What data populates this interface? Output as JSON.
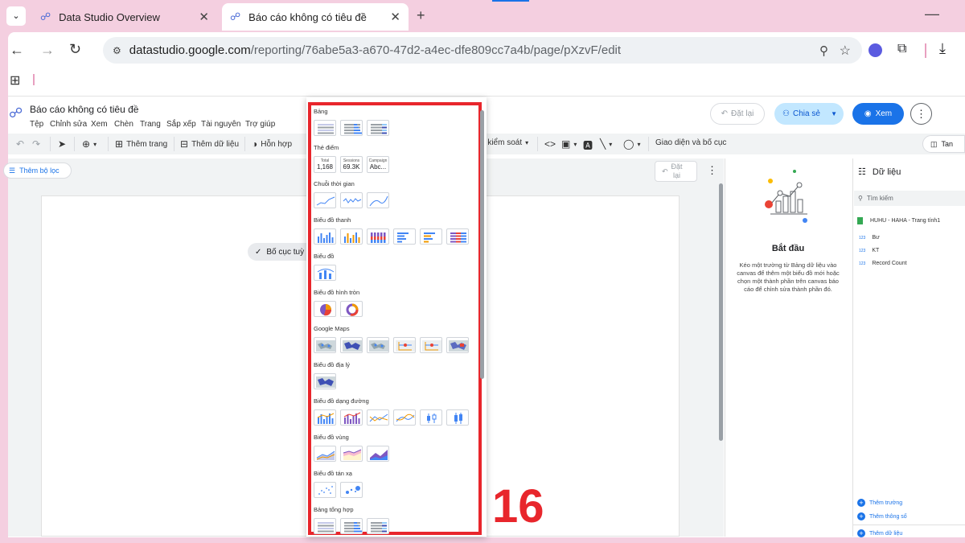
{
  "browser": {
    "tabs": [
      {
        "title": "Data Studio Overview"
      },
      {
        "title": "Báo cáo không có tiêu đề"
      }
    ],
    "url_host": "datastudio.google.com",
    "url_path": "/reporting/76abe5a3-a670-47d2-a4ec-dfe809cc7a4b/page/pXzvF/edit"
  },
  "report": {
    "title": "Báo cáo không có tiêu đề",
    "menu": [
      "Tệp",
      "Chỉnh sửa",
      "Xem",
      "Chèn",
      "Trang",
      "Sắp xếp",
      "Tài nguyên",
      "Trợ giúp"
    ],
    "undo_btn": "Đặt lại",
    "share_btn": "Chia sẻ",
    "view_btn": "Xem"
  },
  "toolbar": {
    "add_page": "Thêm trang",
    "add_data": "Thêm dữ liệu",
    "blend": "Hỗn hợp",
    "controls": "n kiểm soát",
    "theme": "Giao diện và bố cục",
    "right_btn": "Tan"
  },
  "canvas": {
    "add_filter": "Thêm bộ lọc",
    "layout_chip": "Bố cục tuỳ",
    "reset_label_1": "Đặt",
    "reset_label_2": "lại"
  },
  "chart_panel": {
    "categories": {
      "table": "Bảng",
      "scorecard": "Thẻ điểm",
      "timeseries": "Chuỗi thời gian",
      "bar": "Biểu đồ thanh",
      "chart": "Biểu đồ",
      "pie": "Biểu đồ hình tròn",
      "google_maps": "Google Maps",
      "geo": "Biểu đồ địa lý",
      "line": "Biểu đồ dạng đường",
      "area": "Biểu đồ vùng",
      "scatter": "Biểu đồ tán xạ",
      "pivot": "Bảng tổng hợp"
    },
    "scorecards": [
      {
        "label": "Total",
        "value": "1,168"
      },
      {
        "label": "Sessions",
        "value": "69.3K"
      },
      {
        "label": "Campaign",
        "value": "Abc..."
      }
    ]
  },
  "getting_started": {
    "title": "Bắt đầu",
    "body": "Kéo một trường từ Bảng dữ liệu vào canvas để thêm một biểu đồ mới hoặc chọn một thành phần trên canvas báo cáo để chỉnh sửa thành phần đó."
  },
  "data_panel": {
    "title": "Dữ liệu",
    "search_placeholder": "Tìm kiếm",
    "source": "HUHU - HAHA - Trang tính1",
    "fields": [
      {
        "type": "123",
        "name": "Bư"
      },
      {
        "type": "123",
        "name": "KT"
      },
      {
        "type": "123",
        "name": "Record Count"
      }
    ],
    "add_field": "Thêm trường",
    "add_param": "Thêm thông số",
    "add_data": "Thêm dữ liệu"
  },
  "overlay_number": "16",
  "colors": {
    "accent": "#1a73e8",
    "highlight": "#e8262c",
    "bg_pink": "#f4cfe0"
  }
}
